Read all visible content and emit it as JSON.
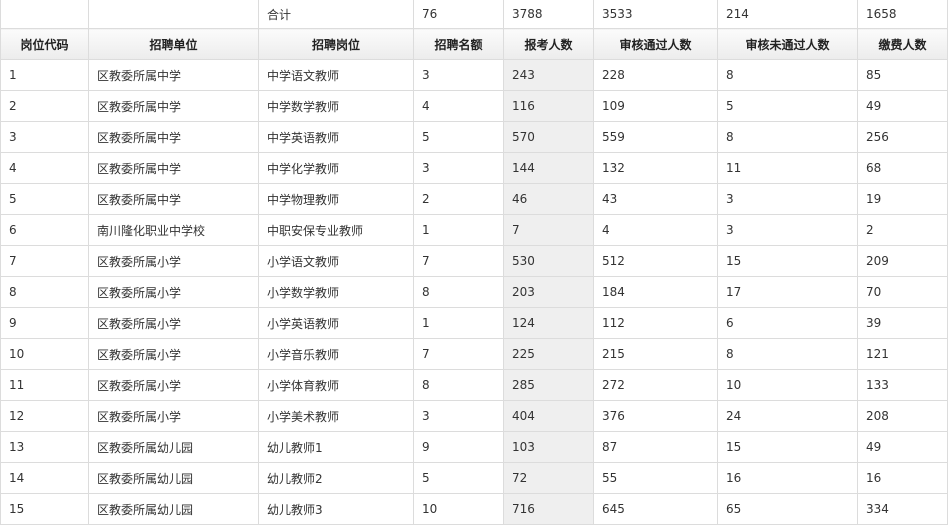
{
  "total_row": [
    "",
    "",
    "合计",
    "76",
    "3788",
    "3533",
    "214",
    "1658"
  ],
  "headers": [
    "岗位代码",
    "招聘单位",
    "招聘岗位",
    "招聘名额",
    "报考人数",
    "审核通过人数",
    "审核未通过人数",
    "缴费人数"
  ],
  "rows": [
    [
      "1",
      "区教委所属中学",
      "中学语文教师",
      "3",
      "243",
      "228",
      "8",
      "85"
    ],
    [
      "2",
      "区教委所属中学",
      "中学数学教师",
      "4",
      "116",
      "109",
      "5",
      "49"
    ],
    [
      "3",
      "区教委所属中学",
      "中学英语教师",
      "5",
      "570",
      "559",
      "8",
      "256"
    ],
    [
      "4",
      "区教委所属中学",
      "中学化学教师",
      "3",
      "144",
      "132",
      "11",
      "68"
    ],
    [
      "5",
      "区教委所属中学",
      "中学物理教师",
      "2",
      "46",
      "43",
      "3",
      "19"
    ],
    [
      "6",
      "南川隆化职业中学校",
      "中职安保专业教师",
      "1",
      "7",
      "4",
      "3",
      "2"
    ],
    [
      "7",
      "区教委所属小学",
      "小学语文教师",
      "7",
      "530",
      "512",
      "15",
      "209"
    ],
    [
      "8",
      "区教委所属小学",
      "小学数学教师",
      "8",
      "203",
      "184",
      "17",
      "70"
    ],
    [
      "9",
      "区教委所属小学",
      "小学英语教师",
      "1",
      "124",
      "112",
      "6",
      "39"
    ],
    [
      "10",
      "区教委所属小学",
      "小学音乐教师",
      "7",
      "225",
      "215",
      "8",
      "121"
    ],
    [
      "11",
      "区教委所属小学",
      "小学体育教师",
      "8",
      "285",
      "272",
      "10",
      "133"
    ],
    [
      "12",
      "区教委所属小学",
      "小学美术教师",
      "3",
      "404",
      "376",
      "24",
      "208"
    ],
    [
      "13",
      "区教委所属幼儿园",
      "幼儿教师1",
      "9",
      "103",
      "87",
      "15",
      "49"
    ],
    [
      "14",
      "区教委所属幼儿园",
      "幼儿教师2",
      "5",
      "72",
      "55",
      "16",
      "16"
    ],
    [
      "15",
      "区教委所属幼儿园",
      "幼儿教师3",
      "10",
      "716",
      "645",
      "65",
      "334"
    ]
  ],
  "colors": {
    "shaded_column": "#efefef",
    "border": "#dcdcdc"
  }
}
